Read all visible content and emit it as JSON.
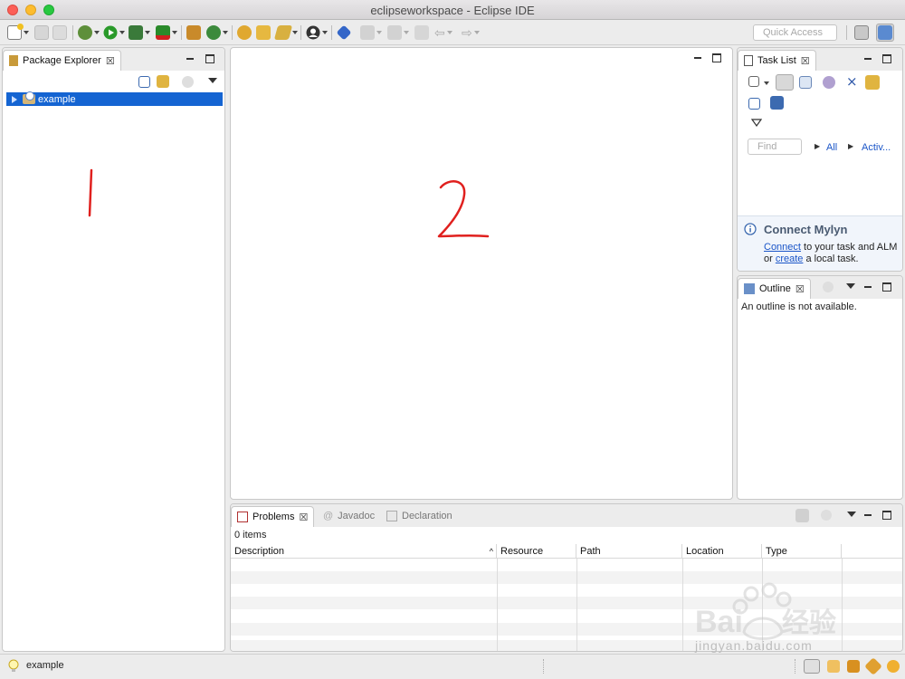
{
  "window": {
    "title": "eclipseworkspace - Eclipse IDE"
  },
  "toolbar": {
    "quick_access_placeholder": "Quick Access"
  },
  "package_explorer": {
    "tab_label": "Package Explorer",
    "tree": [
      {
        "label": "example",
        "selected": true
      }
    ]
  },
  "editor": {},
  "task_list": {
    "tab_label": "Task List",
    "find_placeholder": "Find",
    "filter_all": "All",
    "filter_active": "Activ...",
    "mylyn": {
      "title": "Connect Mylyn",
      "connect_link": "Connect",
      "line1_rest": " to your task and ALM",
      "line2_prefix": "or ",
      "create_link": "create",
      "line2_rest": " a local task."
    }
  },
  "outline": {
    "tab_label": "Outline",
    "message": "An outline is not available."
  },
  "bottom": {
    "tabs": [
      {
        "label": "Problems",
        "active": true
      },
      {
        "label": "Javadoc",
        "active": false
      },
      {
        "label": "Declaration",
        "active": false
      }
    ],
    "items_count": "0 items",
    "columns": [
      "Description",
      "Resource",
      "Path",
      "Location",
      "Type"
    ]
  },
  "status_bar": {
    "text": "example"
  },
  "annotations": [
    "1",
    "2"
  ],
  "watermark": {
    "logo": "Baidu经验",
    "url": "jingyan.baidu.com"
  },
  "colors": {
    "selection": "#1464d2",
    "link": "#1a55c8",
    "annotation": "#e0201e"
  }
}
